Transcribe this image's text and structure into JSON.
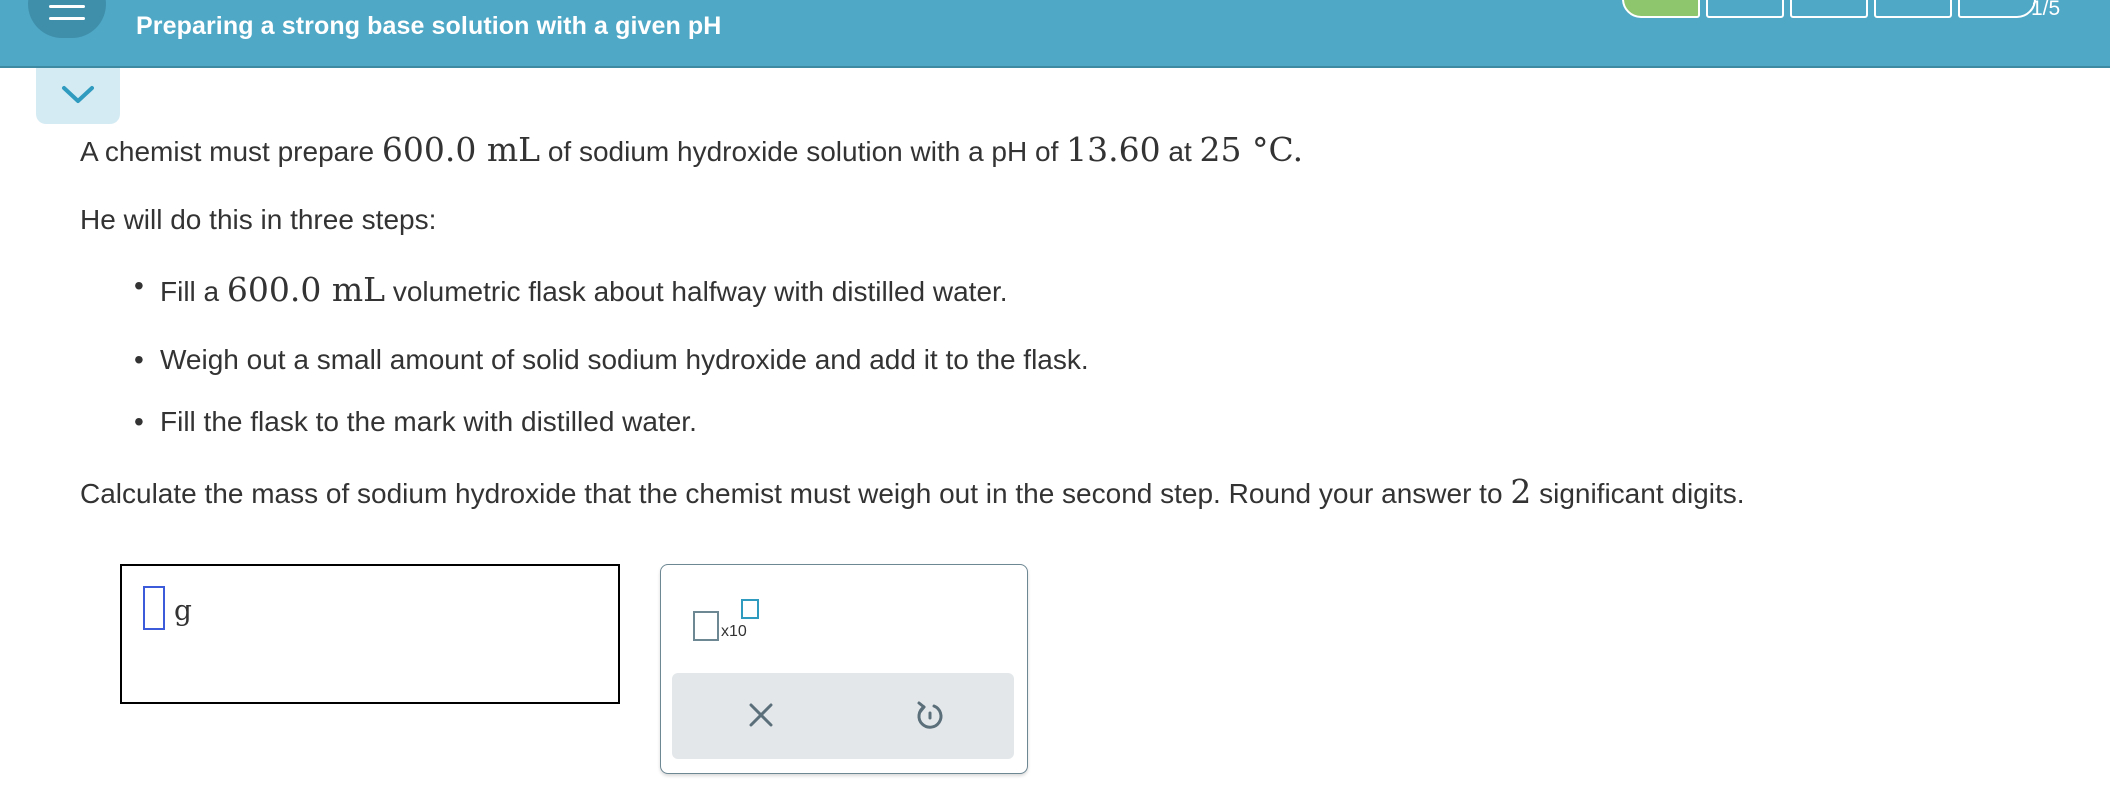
{
  "header": {
    "menu_icon": "hamburger-menu-icon",
    "title": "Preparing a strong base solution with a given pH",
    "progress": {
      "completed": 1,
      "total": 5,
      "label": "1/5"
    },
    "colors": {
      "bar": "#4fa8c6",
      "progress_done": "#8ec66e"
    }
  },
  "collapse": {
    "icon": "chevron-down-icon"
  },
  "problem": {
    "intro": {
      "t1": "A chemist must prepare ",
      "m1": "600.0 mL",
      "t2": " of sodium hydroxide solution with a pH of ",
      "m2": "13.60",
      "t3": " at ",
      "m3": "25 °C",
      "t4": "."
    },
    "steps_intro": "He will do this in three steps:",
    "steps": [
      {
        "t1": "Fill a ",
        "m1": "600.0 mL",
        "t2": " volumetric flask about halfway with distilled water."
      },
      {
        "text": "Weigh out a small amount of solid sodium hydroxide and add it to the flask."
      },
      {
        "text": "Fill the flask to the mark with distilled water."
      }
    ],
    "question": {
      "t1": "Calculate the mass of sodium hydroxide that the chemist must weigh out in the second step. Round your answer to ",
      "m1": "2",
      "t2": " significant digits."
    }
  },
  "answer": {
    "value": "",
    "unit": "g"
  },
  "tools": {
    "sci_notation_label": "x10",
    "clear_icon": "x-icon",
    "undo_icon": "undo-icon"
  }
}
